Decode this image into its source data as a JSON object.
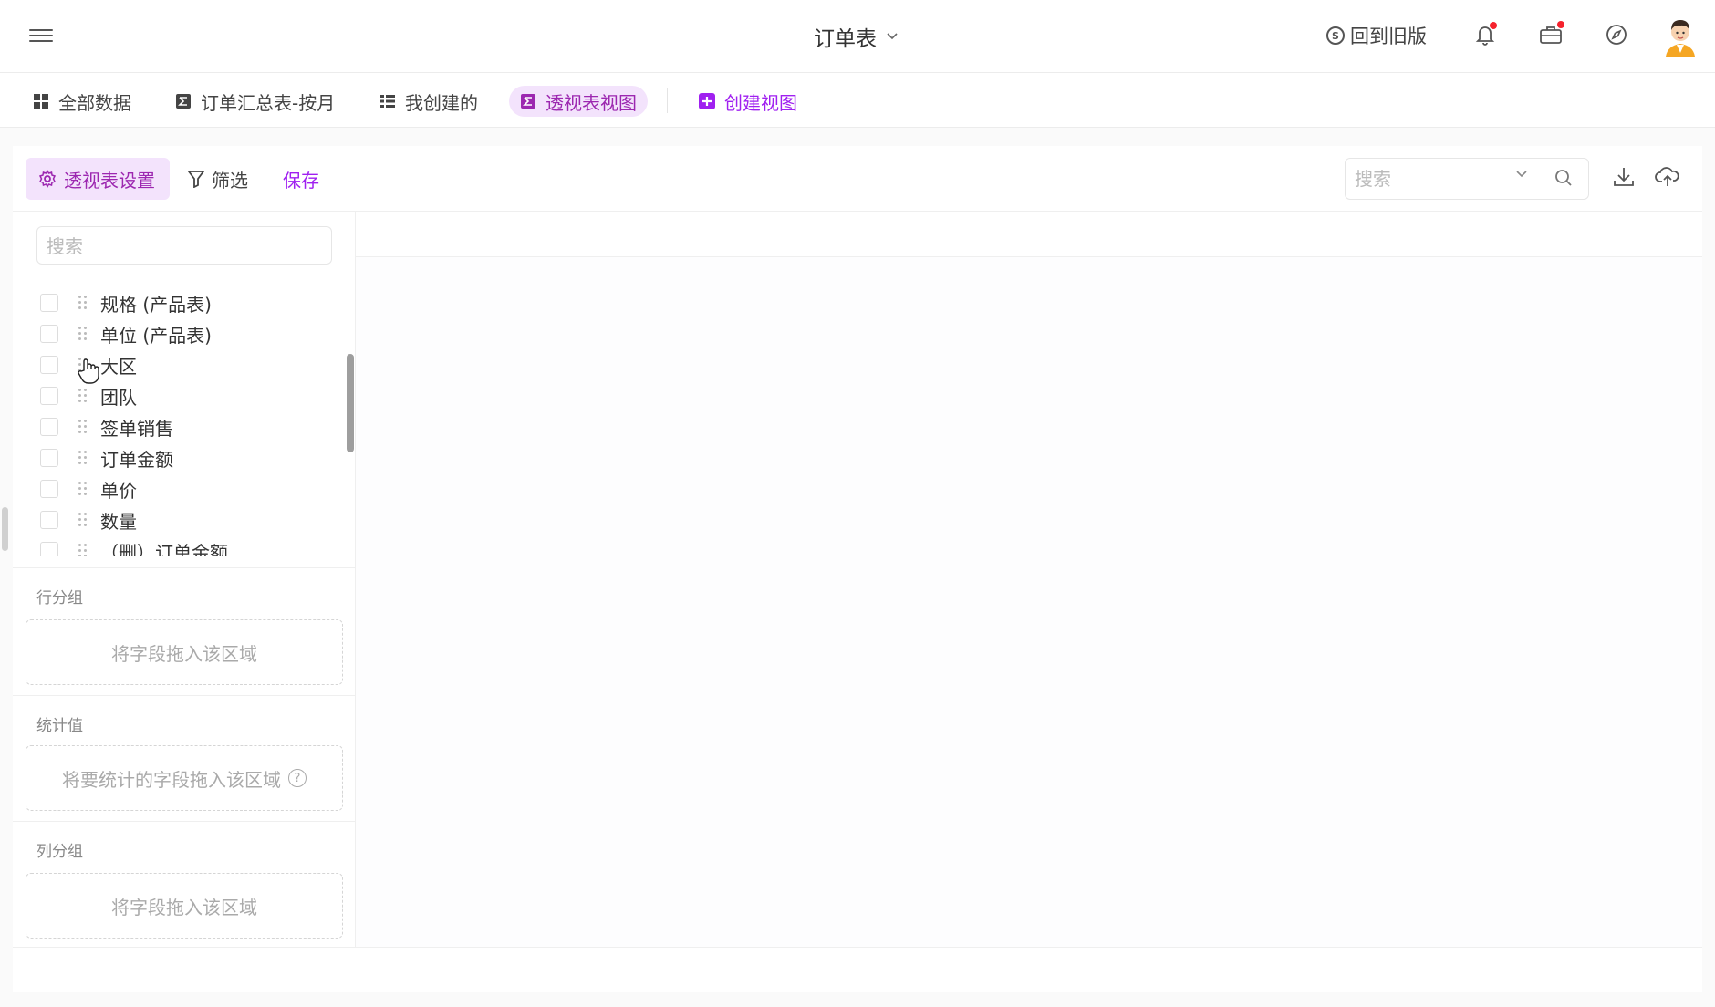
{
  "header": {
    "title": "订单表",
    "back_to_old": "回到旧版",
    "icons": [
      "menu-icon",
      "bell-icon",
      "briefcase-icon",
      "compass-icon",
      "avatar"
    ]
  },
  "tabs": [
    {
      "label": "全部数据",
      "icon": "grid-icon"
    },
    {
      "label": "订单汇总表-按月",
      "icon": "sigma-icon"
    },
    {
      "label": "我创建的",
      "icon": "list-icon"
    },
    {
      "label": "透视表视图",
      "icon": "sigma-icon",
      "active": true
    },
    {
      "label": "创建视图",
      "icon": "plus-square-icon"
    }
  ],
  "toolbar": {
    "settings_label": "透视表设置",
    "filter_label": "筛选",
    "save_label": "保存",
    "search_placeholder": "搜索"
  },
  "fields": {
    "search_placeholder": "搜索",
    "items": [
      {
        "label": "规格 (产品表)"
      },
      {
        "label": "单位 (产品表)"
      },
      {
        "label": "大区"
      },
      {
        "label": "团队"
      },
      {
        "label": "签单销售"
      },
      {
        "label": "订单金额"
      },
      {
        "label": "单价"
      },
      {
        "label": "数量"
      },
      {
        "label": "（删）订单金额"
      }
    ]
  },
  "sections": {
    "row_group": {
      "title": "行分组",
      "placeholder": "将字段拖入该区域"
    },
    "values": {
      "title": "统计值",
      "placeholder": "将要统计的字段拖入该区域"
    },
    "col_group": {
      "title": "列分组",
      "placeholder": "将字段拖入该区域"
    }
  },
  "colors": {
    "accent": "#a020f0",
    "accent_bg": "#f3e3fc",
    "badge": "#f5222d"
  }
}
